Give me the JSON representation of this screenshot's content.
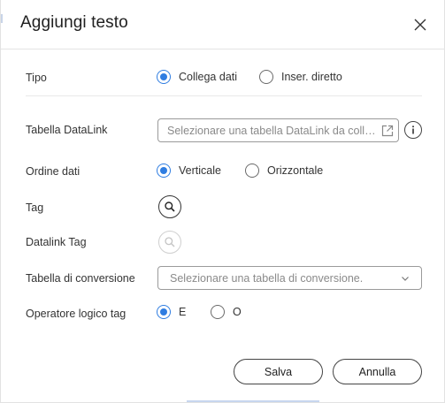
{
  "dialog": {
    "title": "Aggiungi testo",
    "close_icon": "close-icon"
  },
  "tipo": {
    "label": "Tipo",
    "options": [
      {
        "label": "Collega dati",
        "selected": true
      },
      {
        "label": "Inser. diretto",
        "selected": false
      }
    ]
  },
  "datalink_table": {
    "label": "Tabella DataLink",
    "placeholder": "Selezionare una tabella DataLink da colleg...",
    "open_icon": "external-link-icon",
    "info_icon": "info-icon"
  },
  "ordine_dati": {
    "label": "Ordine dati",
    "options": [
      {
        "label": "Verticale",
        "selected": true
      },
      {
        "label": "Orizzontale",
        "selected": false
      }
    ]
  },
  "tag": {
    "label": "Tag",
    "icon": "search-icon"
  },
  "datalink_tag": {
    "label": "Datalink Tag",
    "icon": "search-icon",
    "disabled": true
  },
  "conversion_table": {
    "label": "Tabella di conversione",
    "placeholder": "Selezionare una tabella di conversione.",
    "icon": "chevron-down-icon"
  },
  "operatore": {
    "label": "Operatore logico tag",
    "options": [
      {
        "label": "E",
        "selected": true
      },
      {
        "label": "O",
        "selected": false
      }
    ]
  },
  "footer": {
    "save_label": "Salva",
    "cancel_label": "Annulla"
  },
  "colors": {
    "accent": "#2f7de1",
    "border": "#9a9a9a",
    "text": "#333333"
  }
}
